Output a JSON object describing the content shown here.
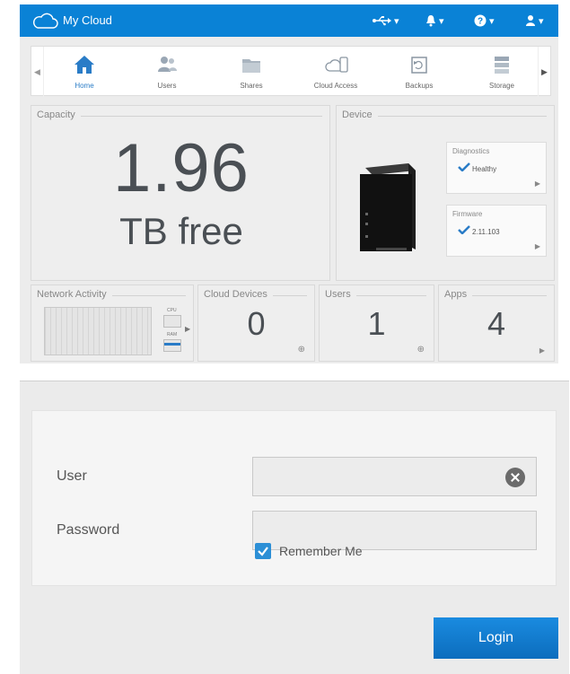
{
  "header": {
    "brand": "My Cloud",
    "icons": [
      "usb-icon",
      "bell-icon",
      "help-icon",
      "user-icon"
    ]
  },
  "nav": {
    "items": [
      {
        "label": "Home",
        "icon": "home-icon",
        "active": true
      },
      {
        "label": "Users",
        "icon": "users-icon",
        "active": false
      },
      {
        "label": "Shares",
        "icon": "shares-icon",
        "active": false
      },
      {
        "label": "Cloud Access",
        "icon": "cloud-access-icon",
        "active": false
      },
      {
        "label": "Backups",
        "icon": "backups-icon",
        "active": false
      },
      {
        "label": "Storage",
        "icon": "storage-icon",
        "active": false
      }
    ]
  },
  "capacity": {
    "title": "Capacity",
    "value": "1.96",
    "unit": "TB free"
  },
  "device": {
    "title": "Device",
    "diagnostics": {
      "title": "Diagnostics",
      "value": "Healthy"
    },
    "firmware": {
      "title": "Firmware",
      "value": "2.11.103"
    }
  },
  "network": {
    "title": "Network Activity",
    "cpu_label": "CPU",
    "ram_label": "RAM"
  },
  "cloud_devices": {
    "title": "Cloud Devices",
    "count": "0"
  },
  "users": {
    "title": "Users",
    "count": "1"
  },
  "apps": {
    "title": "Apps",
    "count": "4"
  },
  "login": {
    "user_label": "User",
    "password_label": "Password",
    "remember_label": "Remember Me",
    "remember_checked": true,
    "login_button": "Login"
  },
  "colors": {
    "accent": "#0a82d6",
    "button": "#1a8be0"
  }
}
